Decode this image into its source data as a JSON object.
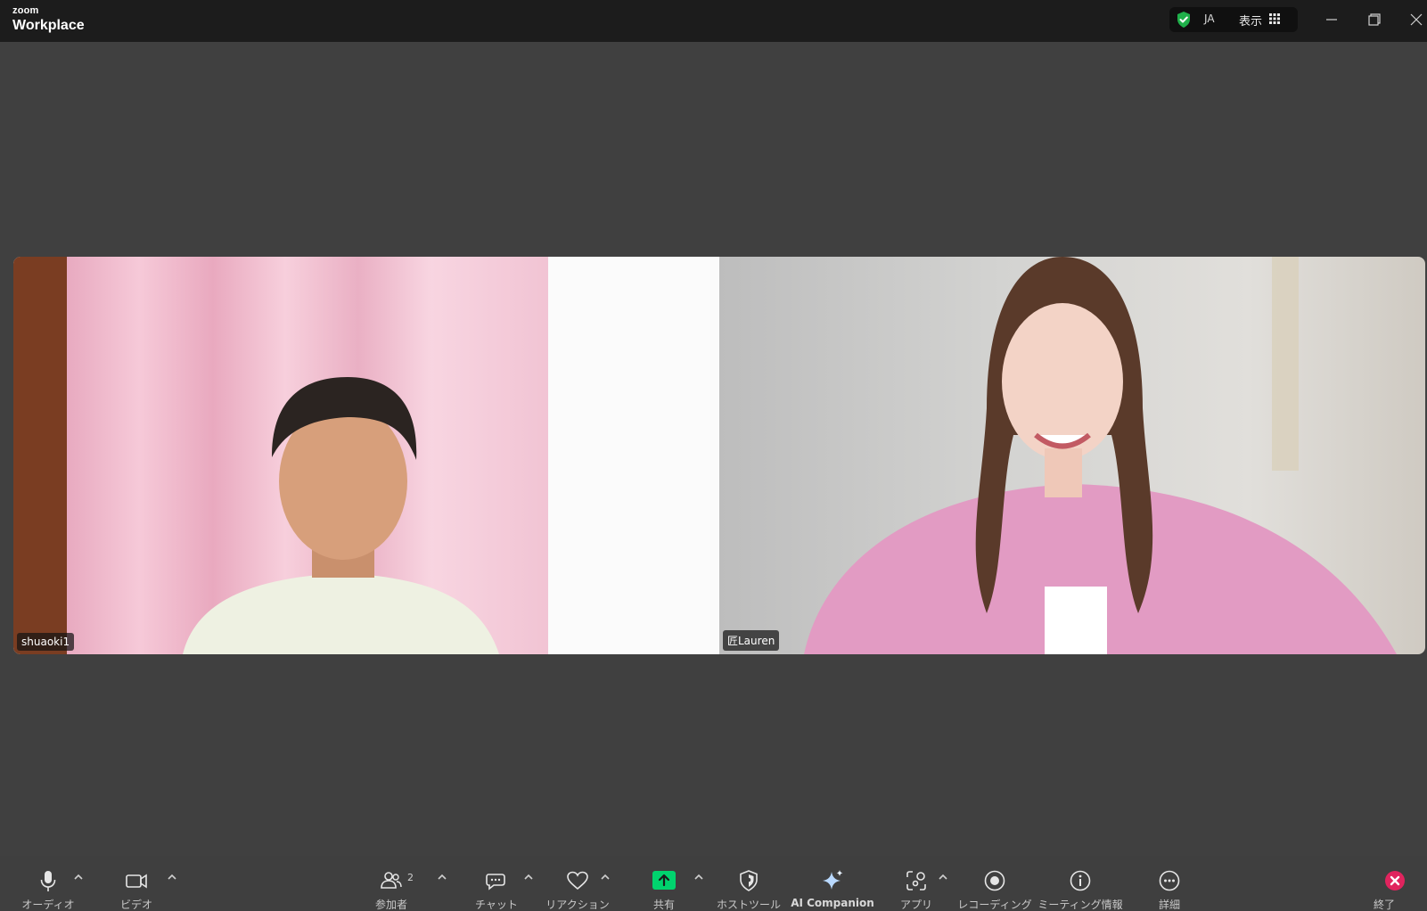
{
  "app": {
    "brand_small": "zoom",
    "brand_name": "Workplace",
    "language": "JA",
    "view_label": "表示",
    "icons": [
      "shield-check-icon",
      "grid-icon",
      "minimize-icon",
      "restore-icon",
      "close-icon"
    ],
    "security_color": "#1fb04a"
  },
  "participants": [
    {
      "name": "shuaoki1"
    },
    {
      "name": "匠Lauren"
    }
  ],
  "toolbar": {
    "audio": "オーディオ",
    "video": "ビデオ",
    "participants": "参加者",
    "participants_count": "2",
    "chat": "チャット",
    "reactions": "リアクション",
    "share": "共有",
    "host_tools": "ホストツール",
    "ai_companion": "AI Companion",
    "apps": "アプリ",
    "recording": "レコーディング",
    "meeting_info": "ミーティング情報",
    "more": "詳細",
    "end": "終了",
    "share_color": "#00d36e",
    "end_color": "#e0245e"
  }
}
